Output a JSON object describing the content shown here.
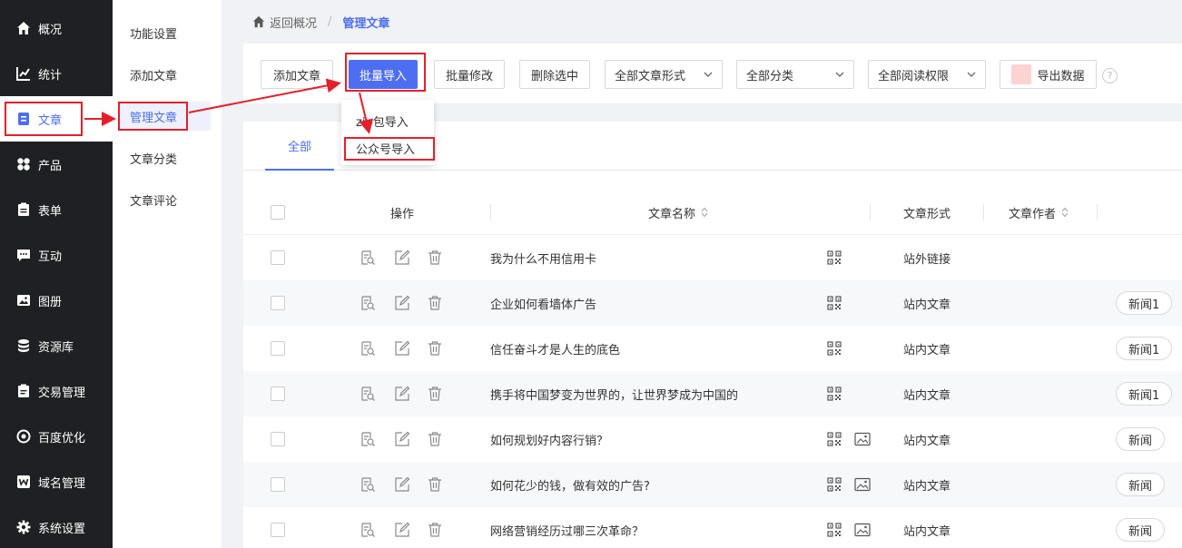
{
  "sidebar": {
    "items": [
      {
        "label": "概况",
        "icon": "home-icon"
      },
      {
        "label": "统计",
        "icon": "stats-icon"
      },
      {
        "label": "文章",
        "icon": "article-icon"
      },
      {
        "label": "产品",
        "icon": "product-icon"
      },
      {
        "label": "表单",
        "icon": "form-icon"
      },
      {
        "label": "互动",
        "icon": "chat-icon"
      },
      {
        "label": "图册",
        "icon": "gallery-icon"
      },
      {
        "label": "资源库",
        "icon": "database-icon"
      },
      {
        "label": "交易管理",
        "icon": "trade-icon"
      },
      {
        "label": "百度优化",
        "icon": "seo-icon"
      },
      {
        "label": "域名管理",
        "icon": "domain-icon"
      },
      {
        "label": "系统设置",
        "icon": "gear-icon"
      }
    ],
    "active_index": 2
  },
  "subnav": {
    "items": [
      "功能设置",
      "添加文章",
      "管理文章",
      "文章分类",
      "文章评论"
    ],
    "active_index": 2
  },
  "breadcrumb": {
    "back_label": "返回概况",
    "separator": "/",
    "current": "管理文章"
  },
  "toolbar": {
    "add_label": "添加文章",
    "batch_import_label": "批量导入",
    "batch_edit_label": "批量修改",
    "delete_label": "删除选中",
    "filter_form": "全部文章形式",
    "filter_category": "全部分类",
    "filter_permission": "全部阅读权限",
    "export_label": "导出数据",
    "help_label": "?"
  },
  "import_menu": {
    "items": [
      "zip包导入",
      "公众号导入"
    ]
  },
  "tabs": {
    "active_label": "全部"
  },
  "table": {
    "headers": {
      "action": "操作",
      "name": "文章名称",
      "form": "文章形式",
      "author": "文章作者"
    },
    "rows": [
      {
        "title": "我为什么不用信用卡",
        "form": "站外链接",
        "has_image": false,
        "category": ""
      },
      {
        "title": "企业如何看墙体广告",
        "form": "站内文章",
        "has_image": false,
        "category": "新闻1"
      },
      {
        "title": "信任奋斗才是人生的底色",
        "form": "站内文章",
        "has_image": false,
        "category": "新闻1"
      },
      {
        "title": "携手将中国梦变为世界的，让世界梦成为中国的",
        "form": "站内文章",
        "has_image": false,
        "category": "新闻1"
      },
      {
        "title": "如何规划好内容行销？",
        "form": "站内文章",
        "has_image": true,
        "category": "新闻"
      },
      {
        "title": "如何花少的钱，做有效的广告?",
        "form": "站内文章",
        "has_image": true,
        "category": "新闻"
      },
      {
        "title": "网络营销经历过哪三次革命？",
        "form": "站内文章",
        "has_image": true,
        "category": "新闻"
      }
    ]
  },
  "colors": {
    "accent": "#4e6ef2",
    "sidebar_bg": "#1f2023",
    "annotation_red": "#e3202b"
  }
}
